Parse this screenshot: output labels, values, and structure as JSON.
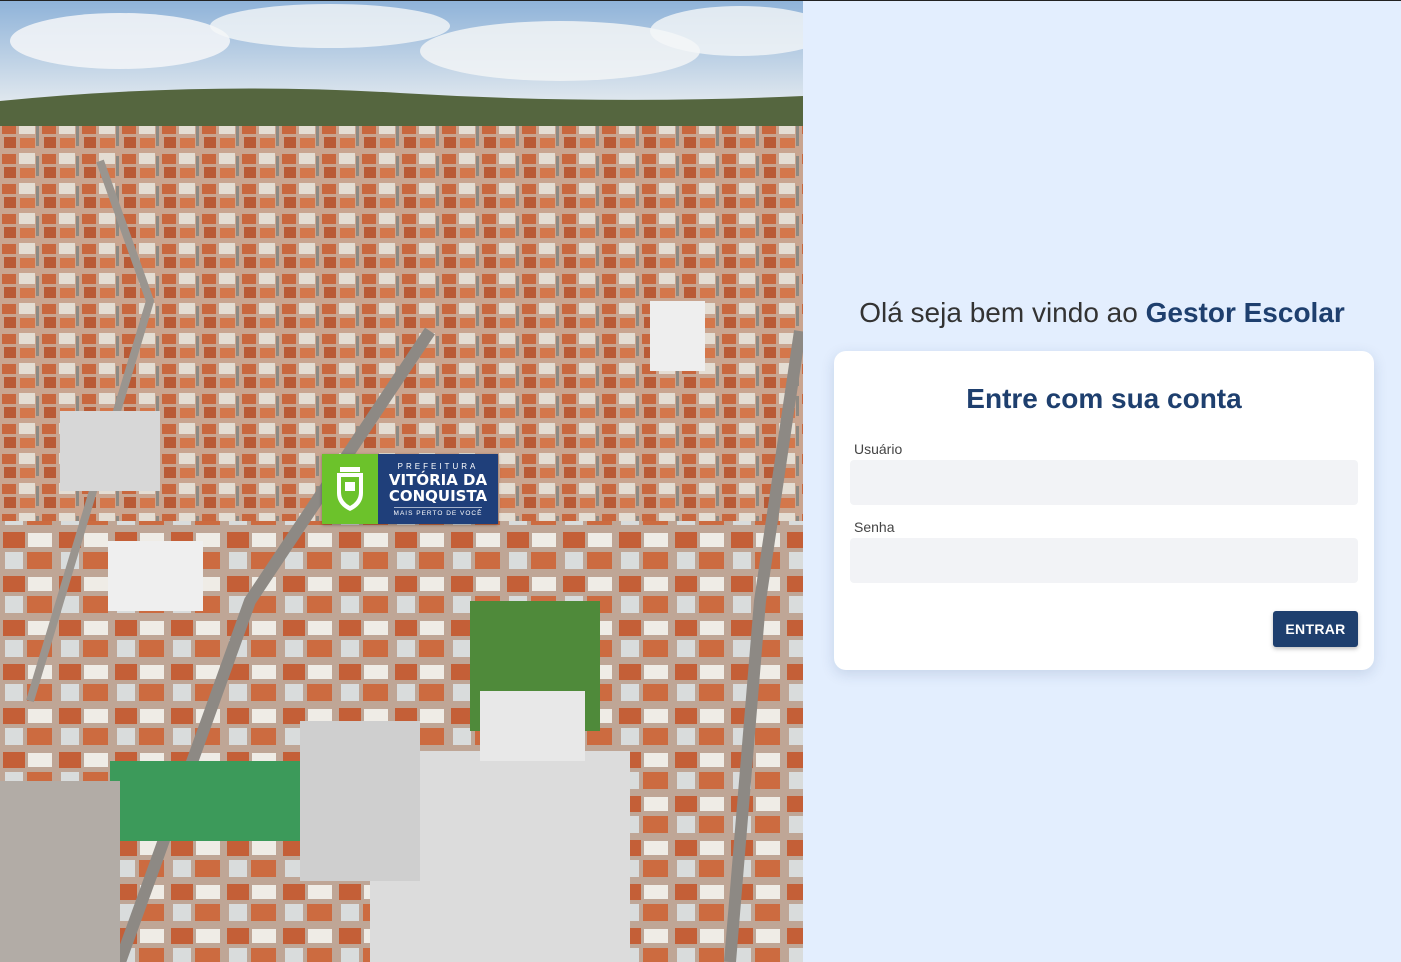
{
  "background_image": {
    "description_icon": "city-aerial-photo"
  },
  "logo": {
    "line1": "PREFEITURA",
    "line2": "VITÓRIA DA",
    "line3": "CONQUISTA",
    "line4": "MAIS PERTO DE VOCÊ",
    "crest_icon": "coat-of-arms-icon",
    "colors": {
      "crest_bg": "#6cc22b",
      "text_bg": "#1f3f7a"
    }
  },
  "welcome": {
    "prefix": "Olá seja bem vindo ao ",
    "brand": "Gestor Escolar"
  },
  "login_card": {
    "title": "Entre com sua conta",
    "username_label": "Usuário",
    "username_value": "",
    "password_label": "Senha",
    "password_value": "",
    "submit_label": "ENTRAR"
  },
  "colors": {
    "panel_bg": "#e3eefe",
    "accent": "#1e3f6e",
    "input_bg": "#f2f3f6"
  }
}
